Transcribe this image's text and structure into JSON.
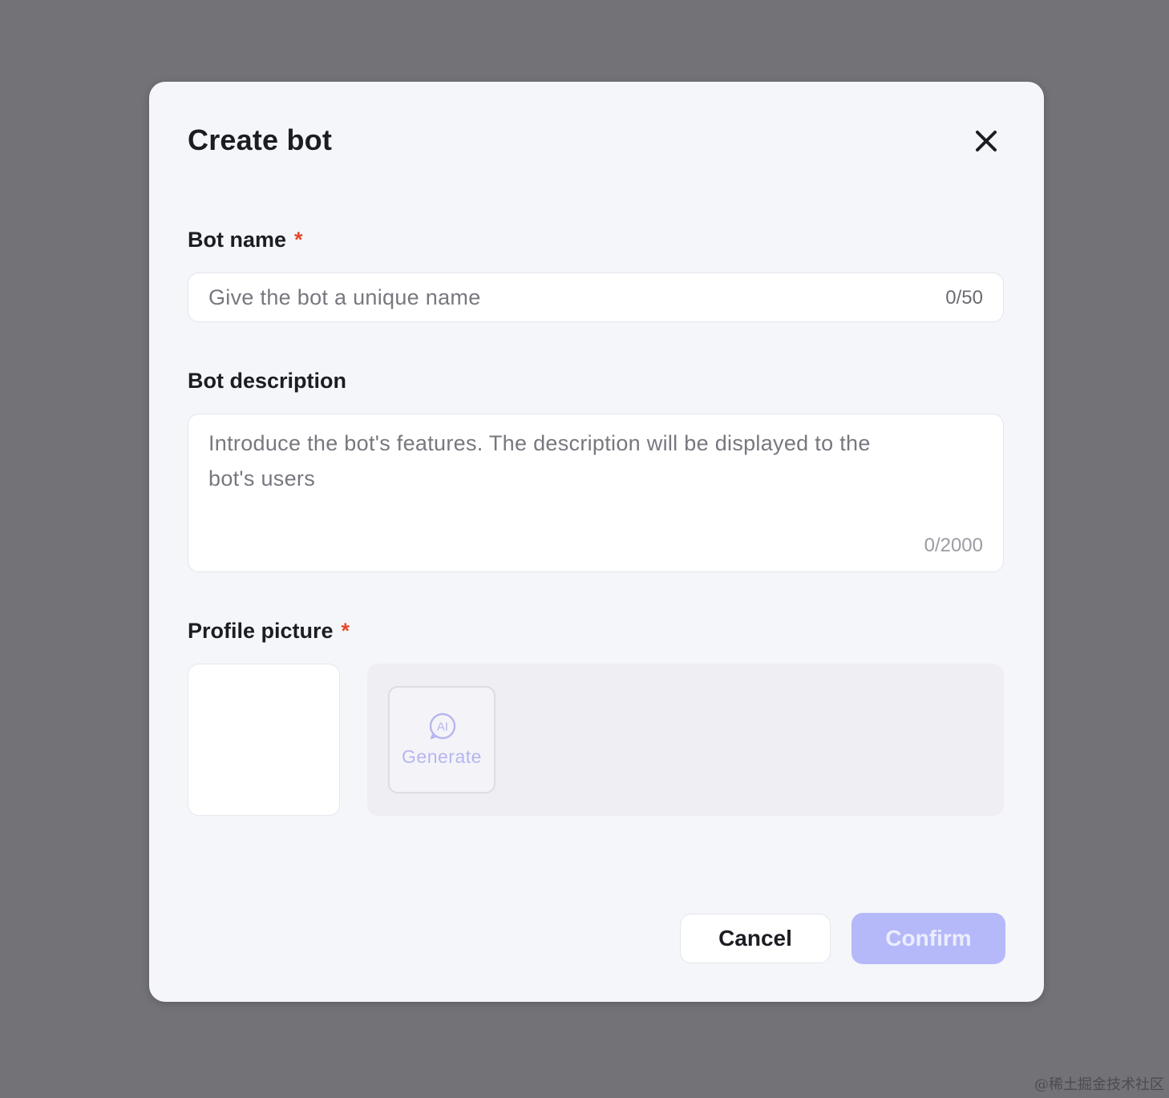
{
  "dialog": {
    "title": "Create bot",
    "close_icon": "close-icon"
  },
  "bot_name": {
    "label": "Bot name",
    "required_mark": "*",
    "placeholder": "Give the bot a unique name",
    "value": "",
    "counter": "0/50"
  },
  "bot_description": {
    "label": "Bot description",
    "placeholder": "Introduce the bot's features. The description will be displayed to the bot's users",
    "value": "",
    "counter": "0/2000"
  },
  "profile_picture": {
    "label": "Profile picture",
    "required_mark": "*",
    "generate_icon": "ai-icon",
    "generate_label": "Generate"
  },
  "footer": {
    "cancel_label": "Cancel",
    "confirm_label": "Confirm"
  },
  "watermark": "@稀土掘金技术社区",
  "colors": {
    "backdrop": "#737277",
    "dialog_bg": "#f4f6fa",
    "required": "#e5482a",
    "confirm_bg": "#b5b9f9",
    "generate_text": "#b6b5f0"
  }
}
